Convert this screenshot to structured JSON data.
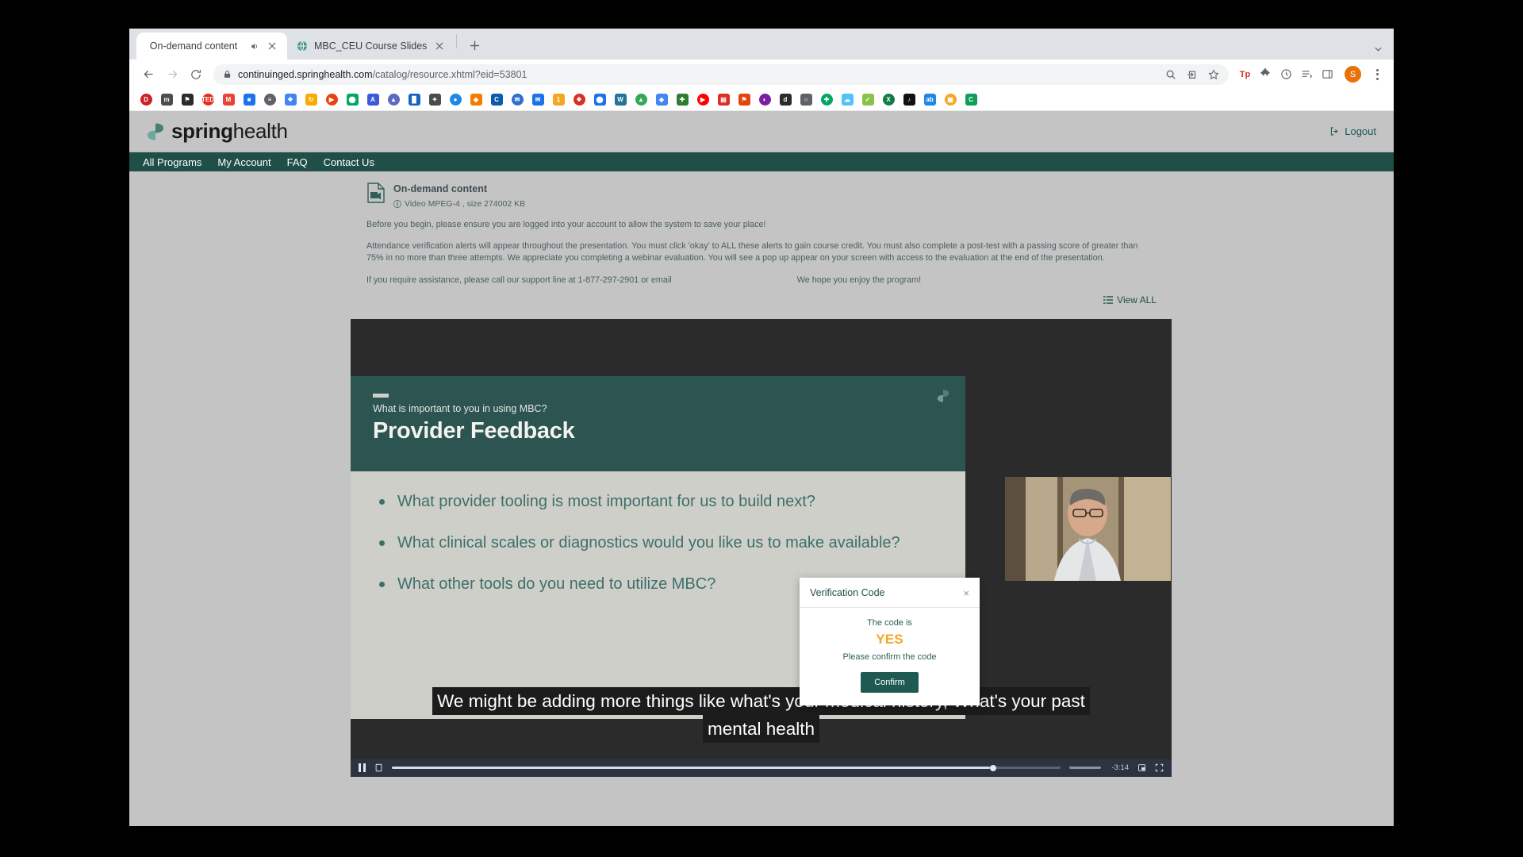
{
  "browser": {
    "tabs": [
      {
        "title": "On-demand content",
        "active": true,
        "audio": true,
        "favicon": "none"
      },
      {
        "title": "MBC_CEU Course Slides",
        "active": false,
        "audio": false,
        "favicon": "globe-icon"
      }
    ],
    "new_tab_label": "+",
    "toolbar": {
      "back_label": "←",
      "forward_label": "→",
      "reload_label": "↻",
      "url_domain": "continuinged.springhealth.com",
      "url_path": "/catalog/resource.xhtml?eid=53801",
      "lock_icon": "lock-icon",
      "zoom_icon": "search-icon",
      "share_icon": "share-icon",
      "bookmark_icon": "star-icon",
      "profile_initial": "S",
      "menu_icon": "kebab-menu-icon"
    },
    "bookmarks": [
      {
        "name": "bookmark-1",
        "glyph": "D",
        "color": "#cc2127"
      },
      {
        "name": "bookmark-2",
        "glyph": "m",
        "color": "#4d4d4d"
      },
      {
        "name": "bookmark-3",
        "glyph": "⚑",
        "color": "#2b2b2b"
      },
      {
        "name": "bookmark-4",
        "glyph": "TED",
        "color": "#e62b1e"
      },
      {
        "name": "bookmark-5",
        "glyph": "M",
        "color": "#ea4335"
      },
      {
        "name": "bookmark-6",
        "glyph": "■",
        "color": "#1a73e8"
      },
      {
        "name": "bookmark-7",
        "glyph": "≡",
        "color": "#5f6368"
      },
      {
        "name": "bookmark-8",
        "glyph": "❖",
        "color": "#4285f4"
      },
      {
        "name": "bookmark-9",
        "glyph": "↻",
        "color": "#f9ab00"
      },
      {
        "name": "bookmark-10",
        "glyph": "▶",
        "color": "#e8430f"
      },
      {
        "name": "bookmark-11",
        "glyph": "⬤",
        "color": "#00a862"
      },
      {
        "name": "bookmark-12",
        "glyph": "A",
        "color": "#3b5bdb"
      },
      {
        "name": "bookmark-13",
        "glyph": "▲",
        "color": "#5c6bc0"
      },
      {
        "name": "bookmark-14",
        "glyph": "█",
        "color": "#1565c0"
      },
      {
        "name": "bookmark-15",
        "glyph": "✦",
        "color": "#4c4c4c"
      },
      {
        "name": "bookmark-16",
        "glyph": "●",
        "color": "#1e88e5"
      },
      {
        "name": "bookmark-17",
        "glyph": "◆",
        "color": "#f57c00"
      },
      {
        "name": "bookmark-18",
        "glyph": "C",
        "color": "#0b5cab"
      },
      {
        "name": "bookmark-19",
        "glyph": "✉",
        "color": "#2f6fd0"
      },
      {
        "name": "bookmark-20",
        "glyph": "✉",
        "color": "#1a73e8"
      },
      {
        "name": "bookmark-21",
        "glyph": "1",
        "color": "#f5a623"
      },
      {
        "name": "bookmark-22",
        "glyph": "❖",
        "color": "#d93025"
      },
      {
        "name": "bookmark-23",
        "glyph": "⬤",
        "color": "#1a73e8"
      },
      {
        "name": "bookmark-24",
        "glyph": "W",
        "color": "#21759b"
      },
      {
        "name": "bookmark-25",
        "glyph": "▲",
        "color": "#34a853"
      },
      {
        "name": "bookmark-26",
        "glyph": "◈",
        "color": "#4285f4"
      },
      {
        "name": "bookmark-27",
        "glyph": "✚",
        "color": "#2e7d32"
      },
      {
        "name": "bookmark-28",
        "glyph": "▶",
        "color": "#ff0000"
      },
      {
        "name": "bookmark-29",
        "glyph": "▤",
        "color": "#d93025"
      },
      {
        "name": "bookmark-30",
        "glyph": "⚑",
        "color": "#e8430f"
      },
      {
        "name": "bookmark-31",
        "glyph": "◐",
        "color": "#7b1fa2"
      },
      {
        "name": "bookmark-32",
        "glyph": "d",
        "color": "#2b2b2b"
      },
      {
        "name": "bookmark-33",
        "glyph": "○",
        "color": "#5f6368"
      },
      {
        "name": "bookmark-34",
        "glyph": "✚",
        "color": "#00a862"
      },
      {
        "name": "bookmark-35",
        "glyph": "☁",
        "color": "#4fc3f7"
      },
      {
        "name": "bookmark-36",
        "glyph": "✓",
        "color": "#8bc34a"
      },
      {
        "name": "bookmark-37",
        "glyph": "X",
        "color": "#107c41"
      },
      {
        "name": "bookmark-38",
        "glyph": "♪",
        "color": "#111111"
      },
      {
        "name": "bookmark-39",
        "glyph": "ab",
        "color": "#1e88e5"
      },
      {
        "name": "bookmark-40",
        "glyph": "▦",
        "color": "#f5a623"
      },
      {
        "name": "bookmark-41",
        "glyph": "C",
        "color": "#0f9d58"
      }
    ]
  },
  "site": {
    "logo_text_bold": "spring",
    "logo_text_light": "health",
    "logout_label": "Logout",
    "nav_items": [
      {
        "label": "All Programs"
      },
      {
        "label": "My Account"
      },
      {
        "label": "FAQ"
      },
      {
        "label": "Contact Us"
      }
    ]
  },
  "resource": {
    "title": "On-demand content",
    "meta": "Video MPEG-4 , size 274002 KB",
    "paragraph_1": "Before you begin, please ensure you are logged into your account to allow the system to save your place!",
    "paragraph_2": "Attendance verification alerts will appear throughout the presentation. You must click 'okay' to ALL these alerts to gain course credit. You must also complete a post-test with a passing score of greater than 75% in no more than three attempts. We appreciate you completing a webinar evaluation. You will see a pop up appear on your screen with access to the evaluation at the end of the presentation.",
    "support_text": "If you require assistance, please call our support line at 1-877-297-2901 or email",
    "enjoy_text": "We hope you enjoy the program!",
    "view_all_label": "View ALL"
  },
  "slide": {
    "kicker": "What is important to you in using MBC?",
    "title": "Provider Feedback",
    "bullets": [
      "What provider tooling is most important for us to build next?",
      "What clinical scales or diagnostics would you like us to make available?",
      "What other tools do you need to utilize MBC?"
    ]
  },
  "player": {
    "caption_line_1": "We might be adding more things like what's your medical history, What's your past",
    "caption_line_2": "mental health",
    "time_remaining": "-3:14",
    "pause_icon": "pause-icon",
    "captions_icon": "closed-captions-icon",
    "pip_icon": "picture-in-picture-icon",
    "fullscreen_icon": "fullscreen-icon",
    "progress_percent": 89.5
  },
  "modal": {
    "title": "Verification Code",
    "close_label": "×",
    "lead": "The code is",
    "code": "YES",
    "sub": "Please confirm the code",
    "confirm_label": "Confirm",
    "code_color": "#f5a623"
  }
}
